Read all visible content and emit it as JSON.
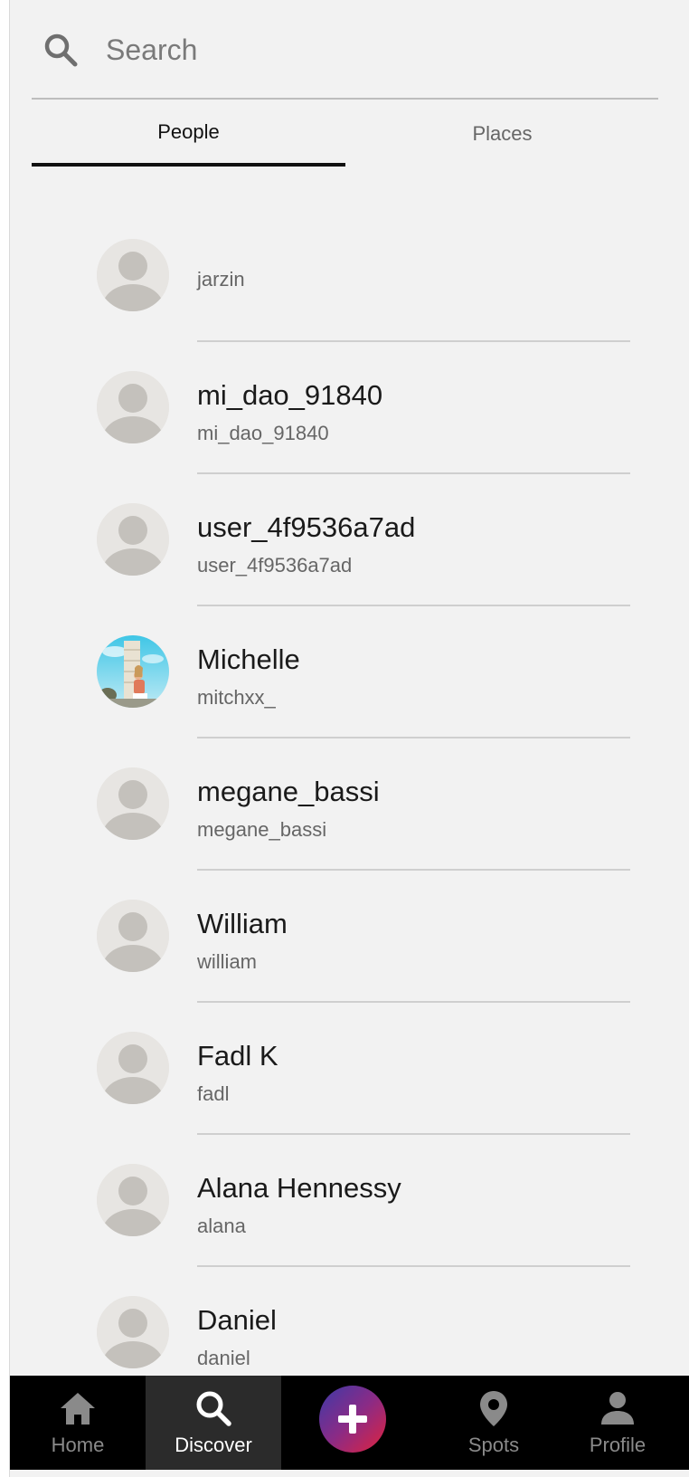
{
  "search": {
    "placeholder": "Search",
    "icon": "search-icon"
  },
  "tabs": [
    {
      "label": "People",
      "active": true
    },
    {
      "label": "Places",
      "active": false
    }
  ],
  "people": [
    {
      "name": "",
      "username": "jarzin",
      "avatar": "default-avatar"
    },
    {
      "name": "mi_dao_91840",
      "username": "mi_dao_91840",
      "avatar": "default-avatar"
    },
    {
      "name": "user_4f9536a7ad",
      "username": "user_4f9536a7ad",
      "avatar": "default-avatar"
    },
    {
      "name": "Michelle",
      "username": "mitchxx_",
      "avatar": "photo-avatar"
    },
    {
      "name": "megane_bassi",
      "username": "megane_bassi",
      "avatar": "default-avatar"
    },
    {
      "name": "William",
      "username": "william",
      "avatar": "default-avatar"
    },
    {
      "name": "Fadl K",
      "username": "fadl",
      "avatar": "default-avatar"
    },
    {
      "name": "Alana Hennessy",
      "username": "alana",
      "avatar": "default-avatar"
    },
    {
      "name": "Daniel",
      "username": "daniel",
      "avatar": "default-avatar"
    }
  ],
  "nav": {
    "items": [
      {
        "label": "Home",
        "icon": "home-icon",
        "active": false
      },
      {
        "label": "Discover",
        "icon": "search-icon",
        "active": true
      },
      {
        "label": "",
        "icon": "plus-icon",
        "active": false
      },
      {
        "label": "Spots",
        "icon": "map-pin-icon",
        "active": false
      },
      {
        "label": "Profile",
        "icon": "person-icon",
        "active": false
      }
    ]
  },
  "colors": {
    "background": "#f2f2f2",
    "nav_background": "#000000",
    "nav_active": "#2b2b2b",
    "add_gradient_start": "#3d3aa8",
    "add_gradient_end": "#e0233e"
  }
}
